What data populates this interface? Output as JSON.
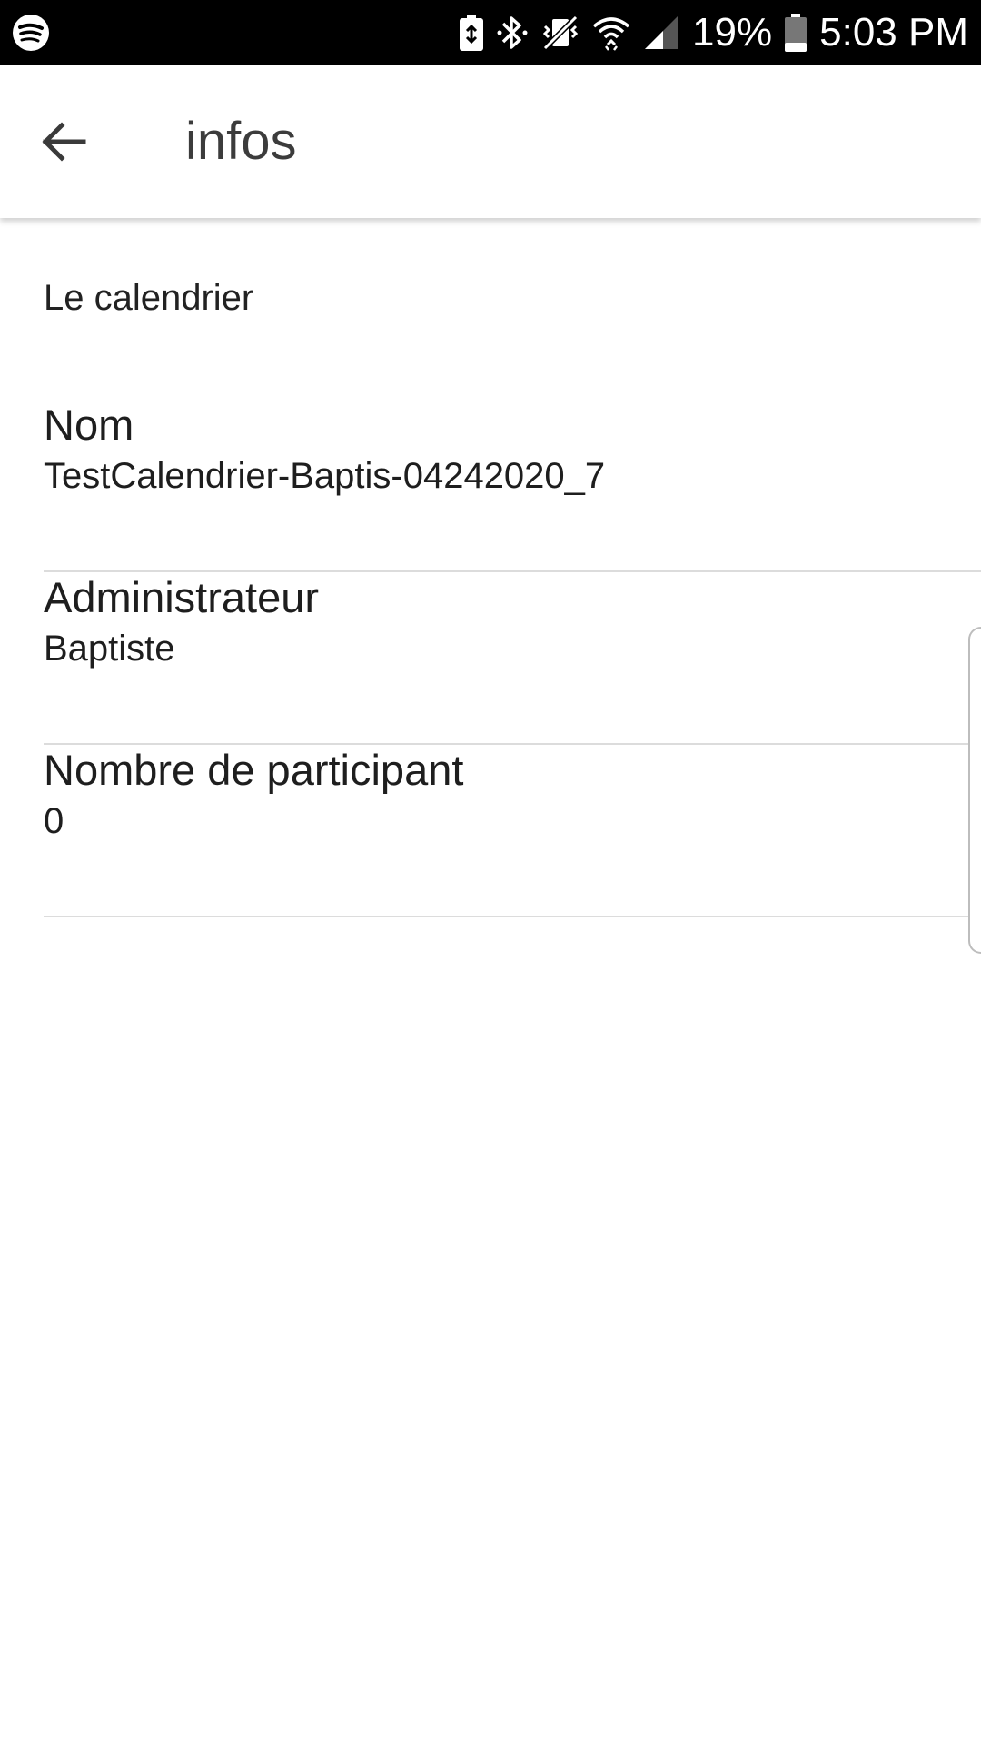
{
  "status_bar": {
    "battery_percent": "19%",
    "time": "5:03 PM",
    "icons": [
      "spotify-icon",
      "battery-saver-icon",
      "bluetooth-icon",
      "vibrate-icon",
      "wifi-icon",
      "signal-icon",
      "battery-icon"
    ]
  },
  "app_bar": {
    "title": "infos",
    "back_icon": "arrow-back-icon"
  },
  "content": {
    "section_title": "Le calendrier",
    "rows": [
      {
        "label": "Nom",
        "value": "TestCalendrier-Baptis-04242020_7"
      },
      {
        "label": "Administrateur",
        "value": "Baptiste"
      },
      {
        "label": "Nombre de participant",
        "value": "0"
      }
    ]
  }
}
